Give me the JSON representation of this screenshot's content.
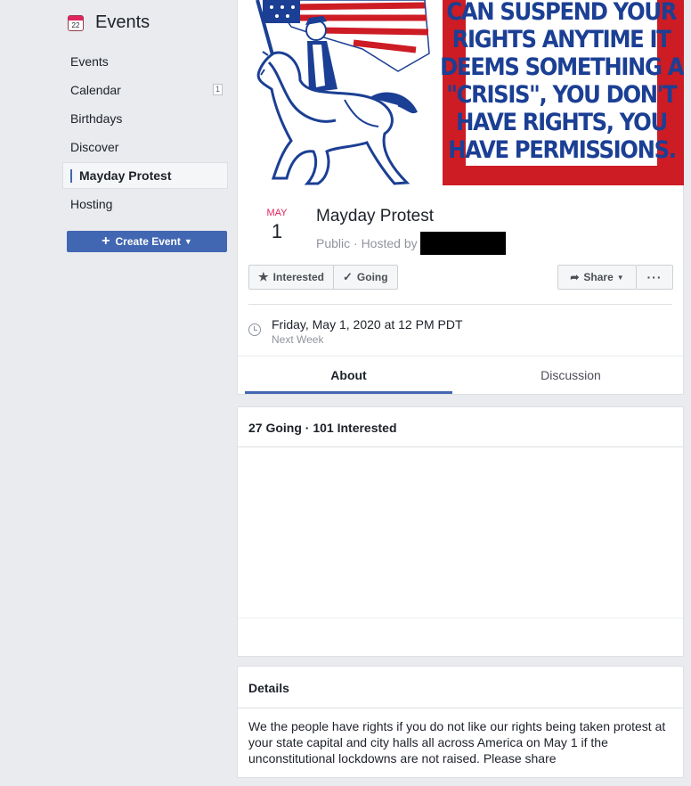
{
  "sidebar": {
    "title": "Events",
    "calendar_icon_number": "22",
    "items": [
      {
        "label": "Events"
      },
      {
        "label": "Calendar",
        "badge": "1"
      },
      {
        "label": "Birthdays"
      },
      {
        "label": "Discover"
      },
      {
        "label": "Mayday Protest",
        "active": true
      },
      {
        "label": "Hosting"
      }
    ],
    "create_button": "Create Event"
  },
  "cover": {
    "lines": [
      "CAN SUSPEND YOUR",
      "RIGHTS ANYTIME IT",
      "DEEMS SOMETHING A",
      "\"CRISIS\", YOU DON'T",
      "HAVE RIGHTS, YOU",
      "HAVE PERMISSIONS."
    ]
  },
  "event": {
    "month": "MAY",
    "day": "1",
    "title": "Mayday Protest",
    "subtitle": "Public · Hosted by",
    "interested_label": "Interested",
    "going_label": "Going",
    "share_label": "Share",
    "more_label": "···",
    "time": "Friday, May 1, 2020 at 12 PM PDT",
    "time_relative": "Next Week"
  },
  "tabs": {
    "about": "About",
    "discussion": "Discussion"
  },
  "attendance": {
    "summary": "27 Going · 101 Interested"
  },
  "details": {
    "title": "Details",
    "text": "We the people have rights if you do not like our rights being taken protest at your state capital and city halls all across America on May 1 if the unconstitutional lockdowns are not raised.  Please share"
  },
  "colors": {
    "brand": "#4267b2",
    "accent_red": "#e0245e",
    "background": "#e9ebee"
  }
}
